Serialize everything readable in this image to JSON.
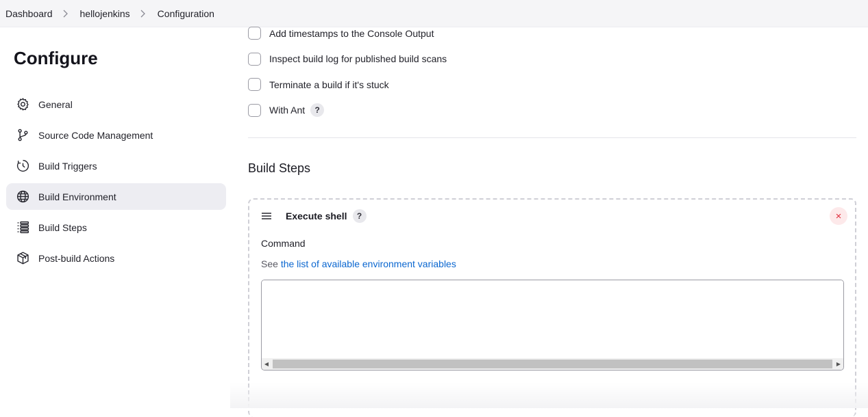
{
  "breadcrumb": {
    "items": [
      "Dashboard",
      "hellojenkins",
      "Configuration"
    ]
  },
  "page": {
    "title": "Configure"
  },
  "sidebar": {
    "items": [
      {
        "label": "General",
        "icon": "gear-icon"
      },
      {
        "label": "Source Code Management",
        "icon": "git-branch-icon"
      },
      {
        "label": "Build Triggers",
        "icon": "clock-icon"
      },
      {
        "label": "Build Environment",
        "icon": "globe-icon",
        "active": true
      },
      {
        "label": "Build Steps",
        "icon": "list-icon"
      },
      {
        "label": "Post-build Actions",
        "icon": "package-icon"
      }
    ]
  },
  "build_environment": {
    "options": [
      {
        "label": "Add timestamps to the Console Output",
        "checked": false
      },
      {
        "label": "Inspect build log for published build scans",
        "checked": false
      },
      {
        "label": "Terminate a build if it's stuck",
        "checked": false
      },
      {
        "label": "With Ant",
        "checked": false,
        "help": "?"
      }
    ]
  },
  "build_steps": {
    "title": "Build Steps",
    "step": {
      "name": "Execute shell",
      "help": "?",
      "delete_symbol": "×",
      "command_label": "Command",
      "see_prefix": "See",
      "env_link": "the list of available environment variables",
      "command_value": ""
    }
  },
  "colors": {
    "accent_link": "#0b67d0",
    "active_nav_bg": "#ededf2",
    "delete_red": "#e02c3c"
  }
}
